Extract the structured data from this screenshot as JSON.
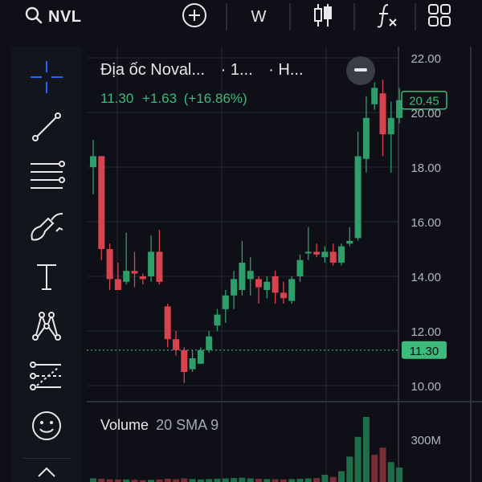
{
  "header": {
    "symbol": "NVL",
    "interval": "W",
    "icons": [
      "search-icon",
      "add-icon",
      "candlestick-icon",
      "indicators-icon",
      "layout-grid-icon"
    ]
  },
  "sidebar": {
    "tools": [
      {
        "name": "crosshair-tool",
        "icon": "crosshair-icon"
      },
      {
        "name": "trend-line-tool",
        "icon": "trend-line-icon"
      },
      {
        "name": "fib-retracement-tool",
        "icon": "fib-lines-icon"
      },
      {
        "name": "brush-tool",
        "icon": "brush-icon"
      },
      {
        "name": "text-tool",
        "icon": "text-icon"
      },
      {
        "name": "patterns-tool",
        "icon": "pattern-icon"
      },
      {
        "name": "prediction-tool",
        "icon": "forecast-icon"
      },
      {
        "name": "emoji-tool",
        "icon": "smiley-icon"
      }
    ]
  },
  "legend": {
    "title": "Địa ốc Noval...",
    "interval": "· 1...",
    "exchange": "· H...",
    "close": "11.30",
    "change": "+1.63",
    "change_pct": "(+16.86%)"
  },
  "volume_legend": {
    "label": "Volume",
    "params": "20 SMA 9"
  },
  "colors": {
    "up": "#26a69a",
    "down": "#ef5350",
    "up_soft": "#2e9e6b",
    "down_soft": "#d8434d",
    "volume_up": "#1f6e4a",
    "volume_down": "#7a2d33",
    "accent": "#2962ff",
    "price_tag": "#3dbb7a"
  },
  "chart_data": {
    "type": "candlestick",
    "y_axis": {
      "min": 10,
      "max": 22,
      "ticks": [
        "22.00",
        "20.00",
        "18.00",
        "16.00",
        "14.00",
        "12.00",
        "10.00"
      ]
    },
    "price_labels": {
      "current": "20.45",
      "crosshair": "11.30"
    },
    "candles": [
      {
        "o": 18.0,
        "h": 19.0,
        "l": 17.0,
        "c": 18.4
      },
      {
        "o": 18.4,
        "h": 18.4,
        "l": 14.6,
        "c": 15.0
      },
      {
        "o": 15.0,
        "h": 15.2,
        "l": 13.5,
        "c": 13.9
      },
      {
        "o": 13.9,
        "h": 14.5,
        "l": 13.6,
        "c": 13.5
      },
      {
        "o": 13.8,
        "h": 15.6,
        "l": 13.7,
        "c": 14.2
      },
      {
        "o": 14.2,
        "h": 14.9,
        "l": 13.6,
        "c": 14.1
      },
      {
        "o": 14.0,
        "h": 14.1,
        "l": 13.7,
        "c": 13.9
      },
      {
        "o": 14.0,
        "h": 15.5,
        "l": 13.8,
        "c": 14.9
      },
      {
        "o": 14.9,
        "h": 15.7,
        "l": 13.7,
        "c": 13.8
      },
      {
        "o": 12.9,
        "h": 13.0,
        "l": 11.4,
        "c": 11.7
      },
      {
        "o": 11.7,
        "h": 12.0,
        "l": 11.1,
        "c": 11.3
      },
      {
        "o": 11.3,
        "h": 11.4,
        "l": 10.1,
        "c": 10.5
      },
      {
        "o": 10.6,
        "h": 11.3,
        "l": 10.5,
        "c": 11.0
      },
      {
        "o": 10.8,
        "h": 11.4,
        "l": 10.8,
        "c": 11.3
      },
      {
        "o": 11.3,
        "h": 12.0,
        "l": 11.2,
        "c": 11.8
      },
      {
        "o": 12.2,
        "h": 12.8,
        "l": 12.0,
        "c": 12.6
      },
      {
        "o": 12.8,
        "h": 13.5,
        "l": 12.3,
        "c": 13.3
      },
      {
        "o": 13.3,
        "h": 14.2,
        "l": 12.8,
        "c": 13.9
      },
      {
        "o": 13.5,
        "h": 15.3,
        "l": 13.3,
        "c": 14.5
      },
      {
        "o": 13.9,
        "h": 14.7,
        "l": 13.3,
        "c": 14.2
      },
      {
        "o": 13.9,
        "h": 14.0,
        "l": 13.0,
        "c": 13.6
      },
      {
        "o": 13.5,
        "h": 14.0,
        "l": 13.2,
        "c": 13.8
      },
      {
        "o": 14.0,
        "h": 14.2,
        "l": 13.0,
        "c": 13.4
      },
      {
        "o": 13.4,
        "h": 13.8,
        "l": 13.0,
        "c": 13.2
      },
      {
        "o": 13.1,
        "h": 14.0,
        "l": 13.0,
        "c": 13.9
      },
      {
        "o": 14.0,
        "h": 14.8,
        "l": 13.8,
        "c": 14.6
      },
      {
        "o": 14.9,
        "h": 15.8,
        "l": 14.6,
        "c": 14.9
      },
      {
        "o": 14.9,
        "h": 15.2,
        "l": 14.7,
        "c": 14.8
      },
      {
        "o": 14.7,
        "h": 15.1,
        "l": 14.5,
        "c": 14.9
      },
      {
        "o": 14.9,
        "h": 15.2,
        "l": 14.4,
        "c": 14.5
      },
      {
        "o": 14.5,
        "h": 15.2,
        "l": 14.4,
        "c": 15.1
      },
      {
        "o": 15.2,
        "h": 15.8,
        "l": 15.1,
        "c": 15.3
      },
      {
        "o": 15.4,
        "h": 19.3,
        "l": 15.3,
        "c": 18.4
      },
      {
        "o": 18.3,
        "h": 20.6,
        "l": 17.8,
        "c": 19.8
      },
      {
        "o": 20.3,
        "h": 21.1,
        "l": 20.1,
        "c": 20.9
      },
      {
        "o": 20.7,
        "h": 21.2,
        "l": 18.4,
        "c": 19.2
      },
      {
        "o": 19.2,
        "h": 20.4,
        "l": 17.8,
        "c": 19.8
      },
      {
        "o": 19.8,
        "h": 20.9,
        "l": 19.6,
        "c": 20.45
      }
    ],
    "volume_ticks": [
      "300M"
    ],
    "volume": [
      {
        "v": 20,
        "up": true
      },
      {
        "v": 18,
        "up": false
      },
      {
        "v": 15,
        "up": false
      },
      {
        "v": 14,
        "up": false
      },
      {
        "v": 14,
        "up": true
      },
      {
        "v": 12,
        "up": false
      },
      {
        "v": 10,
        "up": false
      },
      {
        "v": 12,
        "up": true
      },
      {
        "v": 14,
        "up": false
      },
      {
        "v": 18,
        "up": false
      },
      {
        "v": 15,
        "up": false
      },
      {
        "v": 20,
        "up": false
      },
      {
        "v": 16,
        "up": true
      },
      {
        "v": 14,
        "up": true
      },
      {
        "v": 16,
        "up": true
      },
      {
        "v": 18,
        "up": true
      },
      {
        "v": 20,
        "up": true
      },
      {
        "v": 22,
        "up": true
      },
      {
        "v": 24,
        "up": true
      },
      {
        "v": 20,
        "up": true
      },
      {
        "v": 18,
        "up": false
      },
      {
        "v": 16,
        "up": true
      },
      {
        "v": 15,
        "up": false
      },
      {
        "v": 14,
        "up": false
      },
      {
        "v": 16,
        "up": true
      },
      {
        "v": 18,
        "up": true
      },
      {
        "v": 20,
        "up": true
      },
      {
        "v": 22,
        "up": false
      },
      {
        "v": 40,
        "up": true
      },
      {
        "v": 28,
        "up": false
      },
      {
        "v": 60,
        "up": true
      },
      {
        "v": 140,
        "up": true
      },
      {
        "v": 250,
        "up": true
      },
      {
        "v": 360,
        "up": true
      },
      {
        "v": 150,
        "up": false
      },
      {
        "v": 190,
        "up": false
      },
      {
        "v": 110,
        "up": true
      },
      {
        "v": 80,
        "up": true
      }
    ]
  }
}
